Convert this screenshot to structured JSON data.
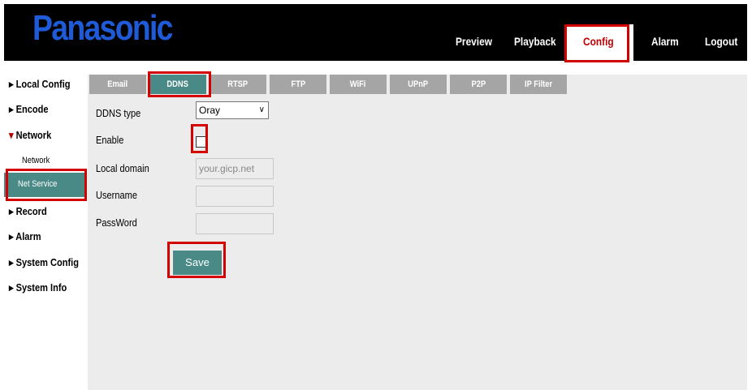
{
  "header": {
    "logo": "Panasonic",
    "nav": [
      "Preview",
      "Playback",
      "Config",
      "Alarm",
      "Logout"
    ],
    "active_nav": "Config"
  },
  "sidebar": {
    "items": [
      "Local Config",
      "Encode",
      "Network",
      "Record",
      "Alarm",
      "System Config",
      "System Info"
    ],
    "sub_items": [
      "Network",
      "Net Service"
    ],
    "active": "Net Service"
  },
  "tabs": [
    "Email",
    "DDNS",
    "RTSP",
    "FTP",
    "WiFi",
    "UPnP",
    "P2P",
    "IP Filter"
  ],
  "active_tab": "DDNS",
  "form": {
    "ddns_type_label": "DDNS type",
    "ddns_type_value": "Oray",
    "enable_label": "Enable",
    "enable_checked": false,
    "local_domain_label": "Local domain",
    "local_domain_placeholder": "your.gicp.net",
    "username_label": "Username",
    "password_label": "PassWord",
    "save_label": "Save"
  },
  "colors": {
    "header_bg": "#000000",
    "logo": "#1f5bd7",
    "accent": "#4a8a86",
    "tab_bg": "#a5a5a5",
    "highlight": "#d40000",
    "content_bg": "#ececec"
  }
}
